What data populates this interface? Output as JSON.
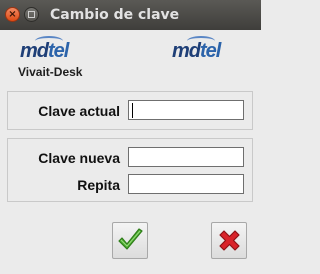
{
  "window": {
    "title": "Cambio de clave"
  },
  "header": {
    "logo_left": {
      "part1": "md",
      "part2": "tel"
    },
    "logo_right": {
      "part1": "md",
      "part2": "tel"
    },
    "app_name": "Vivait-Desk"
  },
  "form": {
    "current_password": {
      "label": "Clave actual",
      "value": ""
    },
    "new_password": {
      "label": "Clave nueva",
      "value": ""
    },
    "repeat_password": {
      "label": "Repita",
      "value": ""
    }
  },
  "colors": {
    "ok_icon": "#4cae2f",
    "cancel_icon": "#d9232a",
    "logo_dark": "#1f3f77",
    "logo_light": "#2b63aa"
  }
}
